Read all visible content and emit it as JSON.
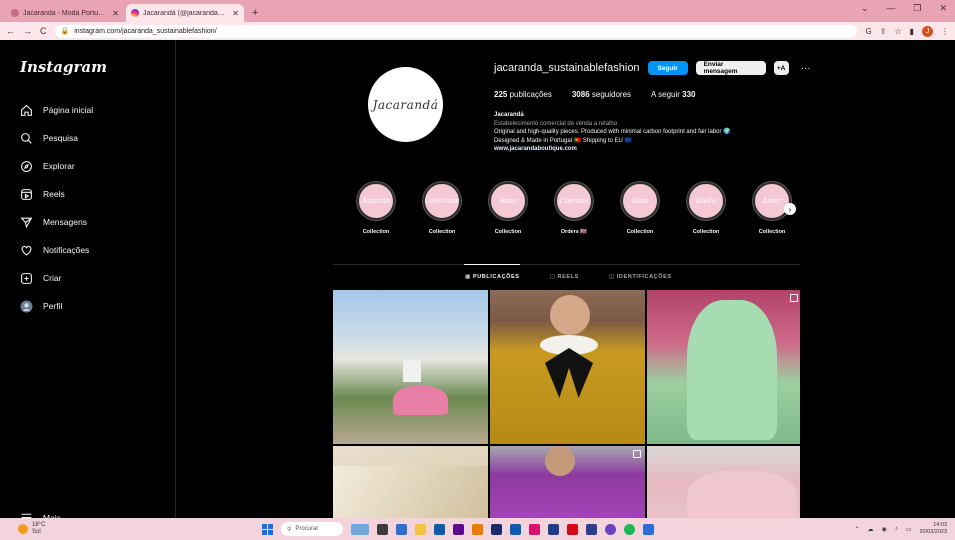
{
  "browser": {
    "tabs": [
      {
        "title": "Jacaranda - Moda Portuguesa S…",
        "active": false,
        "icon": "jacaranda-icon"
      },
      {
        "title": "Jacarandá (@jacaranda_sustaina…",
        "active": true,
        "icon": "instagram-icon"
      }
    ],
    "new_tab": "+",
    "url": "instagram.com/jacaranda_sustainablefashion/"
  },
  "sidebar": {
    "logo": "Instagram",
    "items": [
      {
        "label": "Página inicial",
        "icon": "home-icon"
      },
      {
        "label": "Pesquisa",
        "icon": "search-icon"
      },
      {
        "label": "Explorar",
        "icon": "compass-icon"
      },
      {
        "label": "Reels",
        "icon": "reels-icon"
      },
      {
        "label": "Mensagens",
        "icon": "send-icon"
      },
      {
        "label": "Notificações",
        "icon": "heart-icon"
      },
      {
        "label": "Criar",
        "icon": "plus-square-icon"
      },
      {
        "label": "Perfil",
        "icon": "avatar-icon"
      }
    ],
    "more": "Mais"
  },
  "profile": {
    "avatar_text": "Jacarandá",
    "username": "jacaranda_sustainablefashion",
    "follow_label": "Seguir",
    "message_label": "Enviar mensagem",
    "suggest_label": "+A",
    "more_label": "···",
    "stats": {
      "posts_value": "225",
      "posts_label": "publicações",
      "followers_value": "3086",
      "followers_label": "seguidores",
      "following_label": "A seguir",
      "following_value": "330"
    },
    "bio": {
      "name": "Jacarandá",
      "category": "Estabelecimento comercial de venda a retalho",
      "line1": "Original and high-quality pieces. Produced with minimal carbon footprint and fair labor 🌍",
      "line2": "Designed & Made in Portugal 🇵🇹 Shipping to EU 🇪🇺",
      "link": "www.jacarandaboutique.com"
    }
  },
  "highlights": [
    {
      "cover": "Autumn",
      "label": "Collection"
    },
    {
      "cover": "Celebrate",
      "label": "Collection"
    },
    {
      "cover": "Rosa",
      "label": "Collection"
    },
    {
      "cover": "Clientes",
      "label": "Orders 🇬🇧"
    },
    {
      "cover": "Diva",
      "label": "Collection"
    },
    {
      "cover": "Stella",
      "label": "Collection"
    },
    {
      "cover": "Amor",
      "label": "Collection"
    }
  ],
  "profile_tabs": [
    "PUBLICAÇÕES",
    "REELS",
    "IDENTIFICAÇÕES"
  ],
  "taskbar": {
    "weather_temp": "18°C",
    "weather_desc": "Sol",
    "search": "Procurar",
    "time": "14:03",
    "date": "20/03/2023"
  },
  "colors": {
    "accent": "#0095f6",
    "chrome": "#e8a3b5",
    "background": "#000000"
  }
}
